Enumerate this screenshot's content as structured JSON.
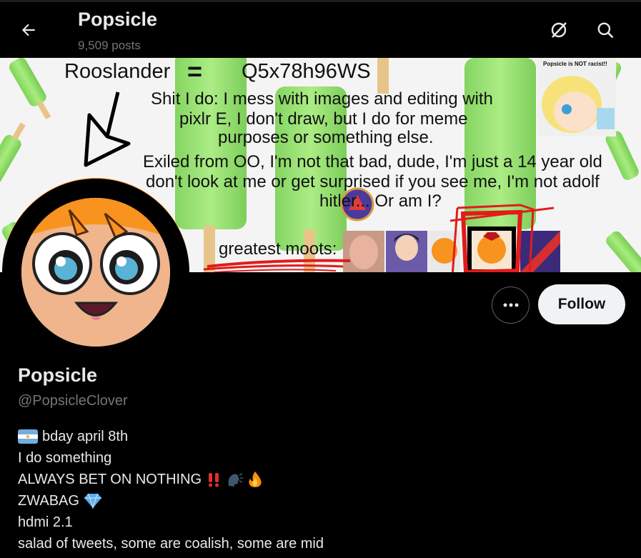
{
  "header": {
    "title": "Popsicle",
    "posts_count": "9,509 posts",
    "back_icon": "arrow-left-icon",
    "grok_icon": "grok-icon",
    "search_icon": "search-icon"
  },
  "banner": {
    "top_left": "Rooslander",
    "top_eq": "=",
    "top_right": "Q5x78h96WS",
    "lines": [
      "Shit I do: I mess with images and editing with",
      "pixlr E, I don't draw, but I do for meme",
      "purposes or something else.",
      "Exiled from OO, I'm not that bad, dude, I'm just a 14 year old",
      "don't look at me or get surprised if you see me, I'm not adolf",
      "hitler... Or am I?"
    ],
    "moots_label": "greatest moots:",
    "corner_note": "Popsicle is NOT racist!!"
  },
  "actions": {
    "more_icon": "more-dots-icon",
    "follow_label": "Follow"
  },
  "profile": {
    "display_name": "Popsicle",
    "handle": "@PopsicleClover"
  },
  "bio": {
    "line1": "bday april 8th",
    "line2": "I do something",
    "line3": "ALWAYS BET ON NOTHING",
    "line4": "ZWABAG",
    "line5": "hdmi 2.1",
    "line6": "salad of tweets, some are coalish, some are mid"
  },
  "colors": {
    "background": "#000000",
    "text_primary": "#e7e9ea",
    "text_secondary": "#71767b",
    "follow_bg": "#eff3f4",
    "popsicle_green": "#8ee06a",
    "avatar_orange": "#f7931e"
  }
}
